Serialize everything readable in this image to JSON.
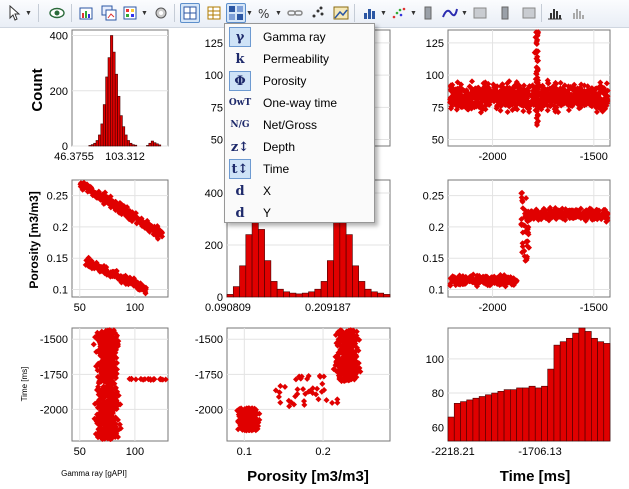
{
  "toolbar": {
    "icons": [
      "cursor-select-icon",
      "eye-icon",
      "add-plot-icon",
      "copy-plot-icon",
      "color-settings-icon",
      "grid-layout-icon",
      "table-icon",
      "plot-matrix-icon",
      "percent-axis-icon",
      "link-icon",
      "points-icon",
      "image-icon",
      "histogram-settings-icon",
      "scatter-settings-icon",
      "bar-icon",
      "curve-icon",
      "rectangle-icon",
      "bar-icon-2",
      "histogram-icon",
      "histogram-icon-2"
    ]
  },
  "menu": {
    "items": [
      {
        "icon": "γ",
        "label": "Gamma ray",
        "selected": true
      },
      {
        "icon": "k",
        "label": "Permeability",
        "selected": false
      },
      {
        "icon": "Φ",
        "label": "Porosity",
        "selected": true
      },
      {
        "icon": "OwT",
        "label": "One-way time",
        "selected": false
      },
      {
        "icon": "N/G",
        "label": "Net/Gross",
        "selected": false
      },
      {
        "icon": "z↕",
        "label": "Depth",
        "selected": false
      },
      {
        "icon": "t↕",
        "label": "Time",
        "selected": true
      },
      {
        "icon": "d",
        "label": "X",
        "selected": false
      },
      {
        "icon": "d",
        "label": "Y",
        "selected": false
      }
    ]
  },
  "axis_titles": {
    "count": "Count",
    "porosity_left": "Porosity [m3/m3]",
    "time_left": "Time [ms]",
    "gamma_bottom": "Gamma ray [gAPI]",
    "porosity_bottom": "Porosity [m3/m3]",
    "time_bottom": "Time [ms]"
  },
  "chart_data": [
    {
      "id": "gamma-histogram",
      "type": "bar",
      "color": "#e00000",
      "xtick_labels": [
        "46.3755",
        "103.312"
      ],
      "yticks": [
        0,
        200,
        400
      ],
      "ylim": [
        0,
        420
      ],
      "values": [
        0,
        0,
        0,
        0,
        0,
        0,
        0,
        2,
        5,
        10,
        20,
        40,
        80,
        150,
        250,
        320,
        400,
        340,
        260,
        180,
        110,
        70,
        40,
        20,
        10,
        5,
        3,
        0,
        0,
        0,
        0,
        2,
        10,
        18,
        12,
        8,
        4,
        0,
        0,
        0
      ]
    },
    {
      "id": "permeability-vs-gamma",
      "type": "scatter",
      "yticks": [
        50,
        75,
        100,
        125
      ]
    },
    {
      "id": "time-vs-gamma-top",
      "type": "scatter",
      "xticks": [
        -2000,
        -1500
      ],
      "yticks": [
        50,
        75,
        100,
        125
      ]
    },
    {
      "id": "gamma-vs-porosity",
      "type": "scatter",
      "xticks": [
        50,
        100
      ],
      "yticks": [
        0.1,
        0.15,
        0.2,
        0.25
      ]
    },
    {
      "id": "porosity-histogram",
      "type": "bar",
      "color": "#e00000",
      "xtick_labels": [
        "0.090809",
        "0.209187"
      ],
      "yticks": [
        0,
        200,
        400
      ],
      "ylim": [
        0,
        450
      ],
      "values": [
        10,
        40,
        120,
        240,
        390,
        260,
        140,
        60,
        30,
        20,
        15,
        12,
        15,
        20,
        30,
        60,
        140,
        360,
        440,
        240,
        120,
        60,
        30,
        20,
        15,
        10
      ]
    },
    {
      "id": "porosity-vs-time",
      "type": "scatter",
      "xticks": [
        -2000,
        -1500
      ],
      "yticks": [
        0.1,
        0.15,
        0.2,
        0.25
      ]
    },
    {
      "id": "time-vs-gamma",
      "type": "scatter",
      "xticks": [
        50,
        100
      ],
      "yticks": [
        -1500,
        -1750,
        -2000
      ]
    },
    {
      "id": "time-vs-porosity",
      "type": "scatter",
      "xticks": [
        0.1,
        0.2
      ],
      "yticks": [
        -1500,
        -1750,
        -2000
      ]
    },
    {
      "id": "time-histogram",
      "type": "bar",
      "color": "#e00000",
      "xtick_labels": [
        "-2218.21",
        "-1706.13"
      ],
      "yticks": [
        60,
        80,
        100
      ],
      "ylim": [
        52,
        118
      ],
      "values": [
        66,
        74,
        75,
        76,
        77,
        78,
        79,
        80,
        81,
        82,
        82,
        83,
        83,
        84,
        83,
        84,
        94,
        108,
        110,
        112,
        115,
        118,
        116,
        112,
        110,
        109
      ]
    }
  ]
}
